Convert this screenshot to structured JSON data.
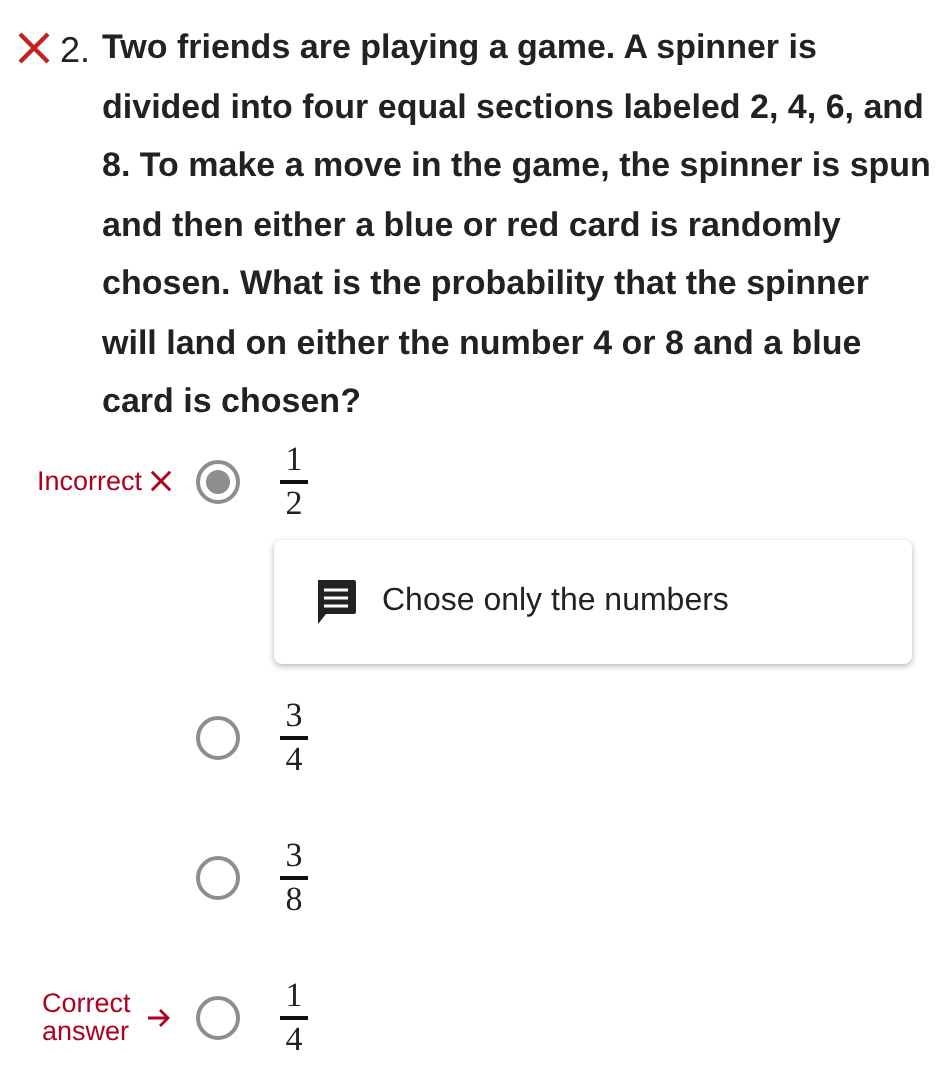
{
  "question": {
    "correct": false,
    "number": "2.",
    "text": "Two friends are playing a game. A spinner is divided into four equal sections labeled 2, 4, 6, and 8. To make a move in the game, the spinner is spun and then either a blue or red card is randomly chosen. What is the probability that the spinner will land on either the number 4 or 8 and a blue card is chosen?"
  },
  "options": [
    {
      "numerator": "1",
      "denominator": "2",
      "selected": true,
      "label": {
        "kind": "incorrect",
        "text": "Incorrect"
      },
      "feedback": "Chose only the numbers"
    },
    {
      "numerator": "3",
      "denominator": "4",
      "selected": false
    },
    {
      "numerator": "3",
      "denominator": "8",
      "selected": false
    },
    {
      "numerator": "1",
      "denominator": "4",
      "selected": false,
      "label": {
        "kind": "correct",
        "text": "Correct answer"
      }
    }
  ]
}
